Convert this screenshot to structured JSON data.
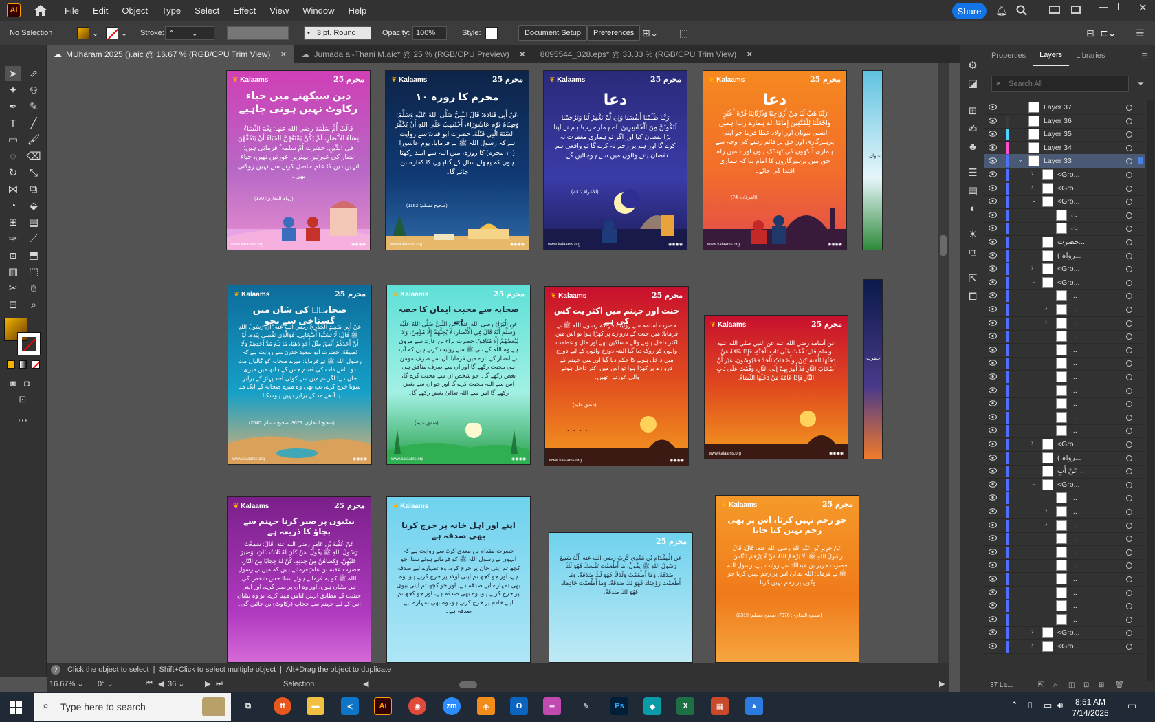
{
  "menu": {
    "items": [
      "File",
      "Edit",
      "Object",
      "Type",
      "Select",
      "Effect",
      "View",
      "Window",
      "Help"
    ],
    "share_label": "Share"
  },
  "control": {
    "selection": "No Selection",
    "stroke_label": "Stroke:",
    "brush": "3 pt. Round",
    "opacity_label": "Opacity:",
    "opacity_value": "100%",
    "style_label": "Style:",
    "document_setup": "Document Setup",
    "preferences": "Preferences"
  },
  "tabs": [
    {
      "label": "MUharam 2025 ().aic @ 16.67 % (RGB/CPU Trim View)"
    },
    {
      "label": "Jumada al-Thani M.aic* @ 25 % (RGB/CPU Preview)"
    },
    {
      "label": "8095544_328.eps* @ 33.33 % (RGB/CPU Trim View)"
    }
  ],
  "artboards": [
    {
      "brand": "Kalaams",
      "badge": "محرم 25",
      "title": "دین سیکھنے میں حیاء رکاوٹ نہیں ہونی چاہیے",
      "body": "قَالَتْ أُمُّ سَلَمَةَ رضي الله عنها: نِعْمَ النِّسَاءُ نِسَاءُ الأَنْصَارِ، لَمْ يَكُنْ يَمْنَعُهُنَّ الحَيَاءُ أَنْ يَتَفَقَّهْنَ فِي الدِّينِ. حضرت اُمّ سلمہ ؓ فرماتی ہیں: انصار کی عورتیں بہترین عورتیں تھیں، حیاء انہیں دین کا علم حاصل کرنے سے نہیں روکتی تھی۔",
      "ref": "(رواہ البخاری: 130)",
      "foot": "www.kalaams.org"
    },
    {
      "brand": "Kalaams",
      "badge": "محرم 25",
      "title": "۱۰ محرم کا روزہ",
      "body": "عَنْ أَبِي قَتَادَةَ: قَالَ النَّبِيُّ صَلَّى اللهُ عَلَيْهِ وَسَلَّمَ: وَصِيَامُ يَوْمِ عَاشُورَاءَ، أَحْتَسِبُ عَلَى اللهِ أَنْ يُكَفِّرَ السَّنَةَ الَّتِي قَبْلَهُ. حضرت ابو قتادہؓ سے روایت ہے کہ رسول اللہ ﷺ نے فرمایا: یوم عاشورا (۱۰ محرم) کا روزہ، میں اللہ سے امید رکھتا ہوں کہ پچھلے سال کے گناہوں کا کفارہ بن جائے گا۔",
      "ref": "(صحیح مسلم: 1162)",
      "foot": "www.kalaams.org"
    },
    {
      "brand": "Kalaams",
      "badge": "محرم 25",
      "title": "دعا",
      "body": "رَبَّنَا ظَلَمْنَا أَنفُسَنَا وَإِن لَّمْ تَغْفِرْ لَنَا وَتَرْحَمْنَا لَنَكُونَنَّ مِنَ الْخَاسِرِينَ. اے ہمارے رب! ہم نے اپنا بڑا نقصان کیا اور اگر تو ہماری مغفرت نہ کرے گا اور ہم پر رحم نہ کرے گا تو واقعی ہم نقصان پانے والوں میں سے ہوجائیں گے۔",
      "ref": "(الأعراف: 23)",
      "foot": "www.kalaams.org"
    },
    {
      "brand": "Kalaams",
      "badge": "محرم 25",
      "title": "دعا",
      "body": "رَبَّنَا هَبْ لَنَا مِنْ أَزْوَاجِنَا وَذُرِّيَّاتِنَا قُرَّةَ أَعْيُنٍ وَاجْعَلْنَا لِلْمُتَّقِينَ إِمَامًا. اے ہمارے رب! ہمیں ایسی بیویاں اور اولاد عطا فرما جو اپنی پرہیزگاری اور حق پر قائم رہنے کی وجہ سے ہماری آنکھوں کی ٹھنڈک ہوں اور ہمیں راہ حق میں پرہیزگاروں کا امام بنا کہ ہماری اقتدا کی جائے۔",
      "ref": "(الفرقان: 74)",
      "foot": "www.kalaams.org"
    },
    {
      "brand": "Kalaams",
      "badge": "محرم 25",
      "title": "صحابہؓ کی شان میں گستاخی سے بچو",
      "body": "عَنْ أَبِي سَعِيدٍ الْخُدْرِيِّ رضي الله عنه، أَنَّ رَسُولَ اللهِ ﷺ قَالَ: لَا تَسُبُّوا أَصْحَابِي، فَوَالَّذِي نَفْسِي بِيَدِهِ، لَوْ أَنَّ أَحَدَكُمْ أَنْفَقَ مِثْلَ أُحُدٍ ذَهَبًا، مَا بَلَغَ مُدَّ أَحَدِهِمْ وَلَا نَصِيفَهُ. حضرت ابو سعید خدریؓ سے روایت ہے کہ رسول اللہ ﷺ نے فرمایا: میرے صحابہ کو گالیاں مت دو۔ اس ذات کی قسم جس کے ہاتھ میں میری جان ہے! اگر تم میں سے کوئی اُحد پہاڑ کے برابر سونا خرچ کرے، تب بھی وہ میرے صحابہ کے ایک مد یا آدھے مد کے برابر نہیں ہوسکتا۔",
      "ref": "(صحیح البخاری: 3673، صحیح مسلم: 2540)",
      "foot": "www.kalaams.org"
    },
    {
      "brand": "Kalaams",
      "badge": "محرم 25",
      "title": "صحابہ سے محبت ایمان کا حصہ ہے",
      "body": "عَنِ الْبَرَاءِ رضي الله عنه، عَنِ النَّبِيِّ صَلَّى اللهُ عَلَيْهِ وَسَلَّمَ أَنَّهُ قَالَ فِي الْأَنْصَارِ: لَا يُحِبُّهُمْ إِلَّا مُؤْمِنٌ، وَلَا يُبْغِضُهُمْ إِلَّا مُنَافِقٌ. حضرت براء بن عازبؓ سے مروی ہے وہ اللہ کے نبی ﷺ سے روایت کرتے ہیں کہ آپ نے انصار کے بارے میں فرمایا: ان سے صرف مومن ہی محبت رکھے گا اور ان سے صرف منافق ہی بغض رکھے گا۔ جو شخص ان سے محبت کرے گا، اس سے اللہ محبت کرے گا اور جو ان سے بغض رکھے گا اس سے اللہ تعالیٰ بغض رکھے گا۔",
      "ref": "(متفق علیہ)",
      "foot": "www.kalaams.org"
    },
    {
      "brand": "Kalaams",
      "badge": "محرم 25",
      "title": "جنت اور جہنم میں اکثر یت کس کی ہے",
      "body": "حضرت اسامہ سے روایت ہے کہ رسول اللہ ﷺ نے فرمایا: میں جنت کے دروازے پر کھڑا ہوا تو اس میں اکثر داخل ہونے والے مساکین تھے اور مال و عظمت والوں کو روک دیا گیا البتہ دوزخ والوں کے لیے دوزخ میں داخل ہونے کا حکم دیا گیا اور میں جہنم کے دروازے پر کھڑا ہوا تو اس میں اکثر داخل ہونے والی عورتیں تھیں۔",
      "ref": "(متفق علیہ)",
      "foot": "www.kalaams.org"
    },
    {
      "brand": "Kalaams",
      "badge": "محرم 25",
      "title": "",
      "body": "عن أسامة رضي الله عنه عن النبي صلى الله عليه وسلم قال: قُمْتُ عَلَى بَابِ الْجَنَّةِ، فَإِذَا عَامَّةُ مَنْ دَخَلَهَا الْمَسَاكِينُ، وَأَصْحَابُ الْجَدِّ مَحْبُوسُونَ، غَيْرَ أَنَّ أَصْحَابَ النَّارِ قَدْ أُمِرَ بِهِمْ إِلَى النَّارِ، وَقُمْتُ عَلَى بَابِ النَّارِ فَإِذَا عَامَّةُ مَنْ دَخَلَهَا النِّسَاءُ.",
      "ref": "",
      "foot": "www.kalaams.org"
    },
    {
      "brand": "Kalaams",
      "badge": "محرم 25",
      "title": "بیٹیوں پر صبر کرنا جہنم سے بچاؤ کا ذریعہ ہے",
      "body": "عَنْ عُقْبَةَ بْنِ عَامِرٍ رضي الله عنه، قَالَ: سَمِعْتُ رَسُولَ اللهِ ﷺ يَقُولُ: مَنْ كَانَ لَهُ ثَلَاثُ بَنَاتٍ، وَصَبَرَ عَلَيْهِنَّ، وَكَسَاهُنَّ مِنْ جِدَتِهِ، كُنَّ لَهُ حِجَابًا مِنَ النَّارِ. حضرت عقبہ بن عامرؓ فرماتے ہیں کہ میں نے رسول اللہ ﷺ کو یہ فرماتے ہوئے سنا: جس شخص کی تین بیٹیاں ہوں، اور وہ ان پر صبر کرے، اور اپنی حیثیت کے مطابق انہیں لباس مہیا کرے، تو وہ بیٹیاں اس کے لیے جہنم سے حجاب (رکاوٹ) بن جائیں گی۔",
      "ref": "",
      "foot": ""
    },
    {
      "brand": "Kalaams",
      "badge": "",
      "title": "اپنے اور اہل خانہ پر خرچ کرنا بھی صدقہ ہے",
      "body": "حضرت مقدام بن معدی کربؓ سے روایت ہے کہ انہوں نے رسول اللہ ﷺ کو فرماتے ہوئے سنا: جو کچھ تم اپنی جان پر خرچ کرو، وہ تمہارے لیے صدقہ ہے، اور جو کچھ تم اپنی اولاد پر خرچ کرتے ہو، وہ بھی تمہارے لیے صدقہ ہے، اور جو کچھ تم اپنی بیوی پر خرچ کرتے ہو، وہ بھی صدقہ ہے، اور جو کچھ تم اپنے خادم پر خرچ کرتے ہو، وہ بھی تمہارے لیے صدقہ ہے۔",
      "ref": "",
      "foot": ""
    },
    {
      "brand": "",
      "badge": "محرم 25",
      "title": "",
      "body": "عَنِ الْمِقْدَامِ بْنِ مَعْدِي كَرِبَ رضي الله عنه. أَنَّهُ سَمِعَ رَسُولَ اللهِ ﷺ يَقُولُ: مَا أَطْعَمْتَ نَفْسَكَ فَهُوَ لَكَ صَدَقَةٌ، وَمَا أَطْعَمْتَ وَلَدَكَ فَهُوَ لَكَ صَدَقَةٌ، وَمَا أَطْعَمْتَ زَوْجَتَكَ فَهُوَ لَكَ صَدَقَةٌ، وَمَا أَطْعَمْتَ خَادِمَكَ فَهُوَ لَكَ صَدَقَةٌ.",
      "ref": "",
      "foot": ""
    },
    {
      "brand": "Kalaams",
      "badge": "محرم 25",
      "title": "جو رحم نہیں کرتا، اس پر بھی رحم نہیں کیا جاتا",
      "body": "عَنْ جَرِيرِ بْنِ عَبْدِ اللهِ رضي الله عنه، قَالَ: قَالَ رَسُولُ اللهِ ﷺ: لَا يَرْحَمُ اللهُ مَنْ لَا يَرْحَمُ النَّاسَ. حضرت جریر بن عبداللہؓ سے روایت ہے، رسول اللہ ﷺ نے فرمایا: اللہ تعالیٰ اس پر رحم نہیں کرتا جو لوگوں پر رحم نہیں کرتا۔",
      "ref": "(صحیح البخاری: 7376، صحیح مسلم: 2319)",
      "foot": ""
    }
  ],
  "partial_artboard_texts": {
    "row1": "عنوان",
    "row2": "حضرت",
    "row3": "رواہ"
  },
  "status": {
    "hint1": "Click the object to select",
    "hint2": "Shift+Click to select multiple object",
    "hint3": "Alt+Drag the object to duplicate",
    "zoom": "16.67%",
    "rotation": "0°",
    "artboard_num": "36",
    "tool": "Selection"
  },
  "panel": {
    "tabs": [
      "Properties",
      "Layers",
      "Libraries"
    ],
    "search_placeholder": "Search All",
    "layers": [
      {
        "name": "Layer 37",
        "color": "#333333",
        "indent": 0,
        "expand": ""
      },
      {
        "name": "Layer 36",
        "color": "#3a3a3a",
        "indent": 0,
        "expand": ""
      },
      {
        "name": "Layer 35",
        "color": "#4fd3ff",
        "indent": 0,
        "expand": ""
      },
      {
        "name": "Layer 34",
        "color": "#ff4fd0",
        "indent": 0,
        "expand": ""
      },
      {
        "name": "Layer 33",
        "color": "#4f6fff",
        "indent": 0,
        "expand": "open",
        "selected": true
      },
      {
        "name": "<Gro...",
        "color": "#4f6fff",
        "indent": 1,
        "expand": "closed"
      },
      {
        "name": "<Gro...",
        "color": "#4f6fff",
        "indent": 1,
        "expand": "closed"
      },
      {
        "name": "<Gro...",
        "color": "#4f6fff",
        "indent": 1,
        "expand": "open"
      },
      {
        "name": "ت...",
        "color": "#4f6fff",
        "indent": 2,
        "expand": ""
      },
      {
        "name": "ت...",
        "color": "#4f6fff",
        "indent": 2,
        "expand": ""
      },
      {
        "name": "حضرت...",
        "color": "#4f6fff",
        "indent": 1,
        "expand": ""
      },
      {
        "name": "( رواہ...",
        "color": "#4f6fff",
        "indent": 1,
        "expand": ""
      },
      {
        "name": "<Gro...",
        "color": "#4f6fff",
        "indent": 1,
        "expand": "closed"
      },
      {
        "name": "<Gro...",
        "color": "#4f6fff",
        "indent": 1,
        "expand": "open"
      },
      {
        "name": "...",
        "color": "#4f6fff",
        "indent": 2,
        "expand": ""
      },
      {
        "name": "...",
        "color": "#4f6fff",
        "indent": 2,
        "expand": "closed"
      },
      {
        "name": "...",
        "color": "#4f6fff",
        "indent": 2,
        "expand": "closed"
      },
      {
        "name": "...",
        "color": "#4f6fff",
        "indent": 2,
        "expand": ""
      },
      {
        "name": "...",
        "color": "#4f6fff",
        "indent": 2,
        "expand": ""
      },
      {
        "name": "...",
        "color": "#4f6fff",
        "indent": 2,
        "expand": ""
      },
      {
        "name": "...",
        "color": "#4f6fff",
        "indent": 2,
        "expand": ""
      },
      {
        "name": "...",
        "color": "#4f6fff",
        "indent": 2,
        "expand": ""
      },
      {
        "name": "...",
        "color": "#4f6fff",
        "indent": 2,
        "expand": ""
      },
      {
        "name": "...",
        "color": "#4f6fff",
        "indent": 2,
        "expand": ""
      },
      {
        "name": "...",
        "color": "#4f6fff",
        "indent": 2,
        "expand": ""
      },
      {
        "name": "<Gro...",
        "color": "#4f6fff",
        "indent": 1,
        "expand": "closed"
      },
      {
        "name": "( رواہ...",
        "color": "#4f6fff",
        "indent": 1,
        "expand": ""
      },
      {
        "name": "عَنْ أَبِ...",
        "color": "#4f6fff",
        "indent": 1,
        "expand": ""
      },
      {
        "name": "<Gro...",
        "color": "#4f6fff",
        "indent": 1,
        "expand": "open"
      },
      {
        "name": "...",
        "color": "#4f6fff",
        "indent": 2,
        "expand": ""
      },
      {
        "name": "...",
        "color": "#4f6fff",
        "indent": 2,
        "expand": "closed"
      },
      {
        "name": "...",
        "color": "#4f6fff",
        "indent": 2,
        "expand": "closed"
      },
      {
        "name": "...",
        "color": "#4f6fff",
        "indent": 2,
        "expand": ""
      },
      {
        "name": "...",
        "color": "#4f6fff",
        "indent": 2,
        "expand": ""
      },
      {
        "name": "...",
        "color": "#4f6fff",
        "indent": 2,
        "expand": ""
      },
      {
        "name": "...",
        "color": "#4f6fff",
        "indent": 2,
        "expand": ""
      },
      {
        "name": "...",
        "color": "#4f6fff",
        "indent": 2,
        "expand": ""
      },
      {
        "name": "...",
        "color": "#4f6fff",
        "indent": 2,
        "expand": ""
      },
      {
        "name": "...",
        "color": "#4f6fff",
        "indent": 2,
        "expand": ""
      },
      {
        "name": "<Gro...",
        "color": "#4f6fff",
        "indent": 1,
        "expand": "closed"
      },
      {
        "name": "<Gro...",
        "color": "#4f6fff",
        "indent": 1,
        "expand": "closed"
      }
    ],
    "footer_count": "37 La..."
  },
  "taskbar": {
    "search_placeholder": "Type here to search",
    "time": "8:51 AM",
    "date": "7/14/2025"
  }
}
